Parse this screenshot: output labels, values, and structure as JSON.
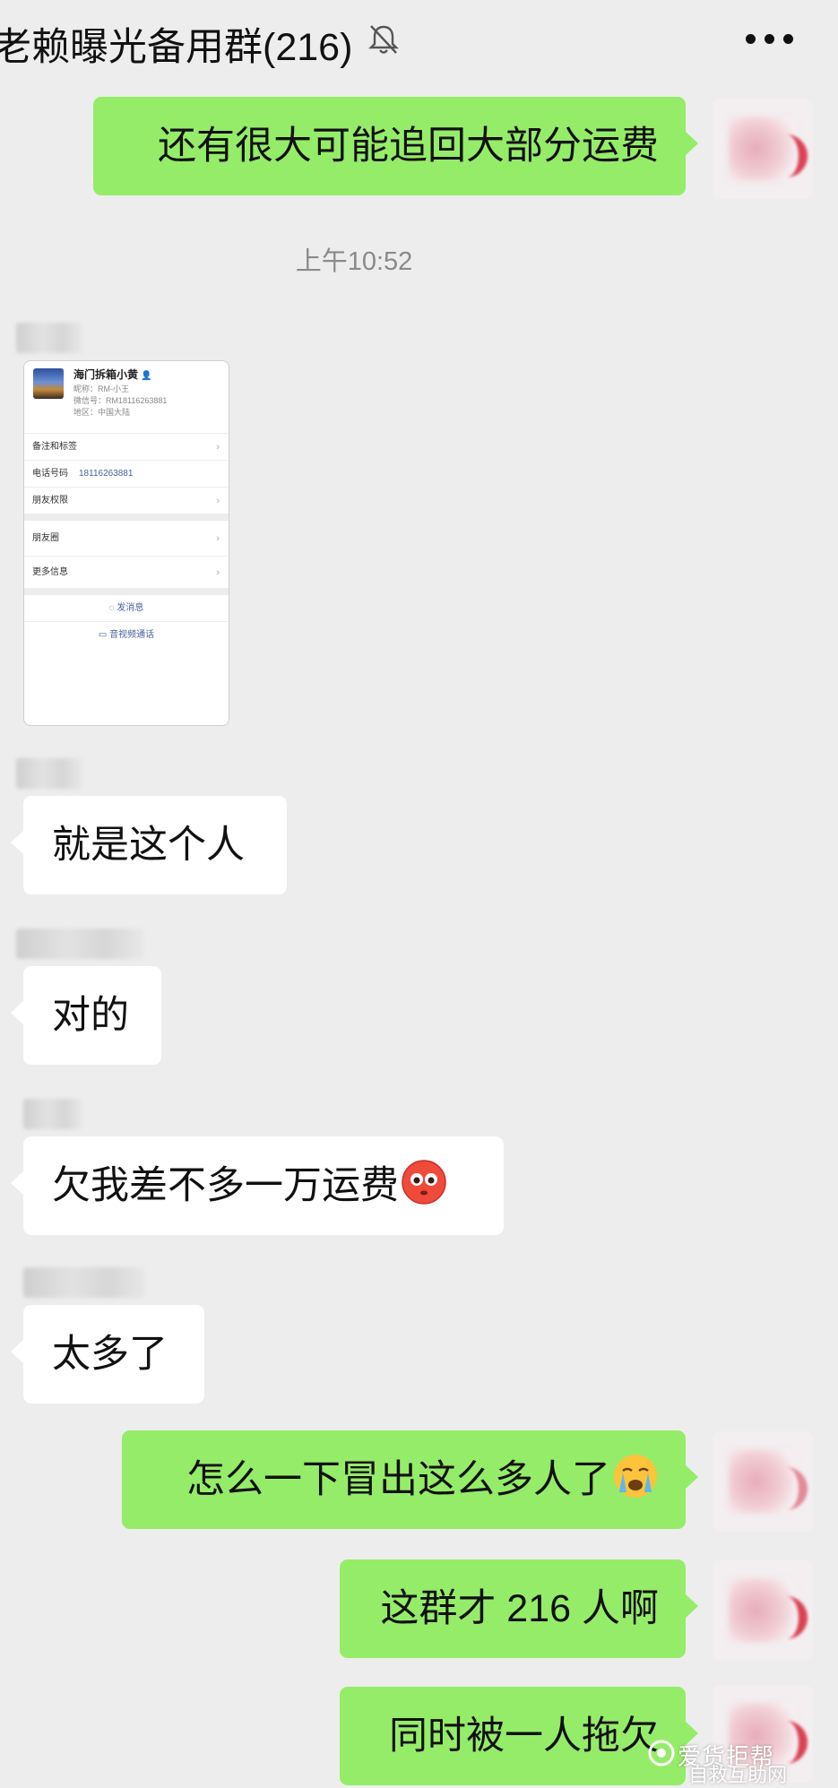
{
  "header": {
    "title": "老赖曝光备用群(216)",
    "mute_icon": "bell-off-icon",
    "more_icon": "more-dots-icon"
  },
  "timestamp": "上午10:52",
  "messages": {
    "m1": {
      "side": "right",
      "text": "还有很大可能追回大部分运费"
    },
    "m3": {
      "side": "left",
      "text": "就是这个人"
    },
    "m4": {
      "side": "left",
      "text": "对的"
    },
    "m5": {
      "side": "left",
      "text": "欠我差不多一万运费",
      "emoji": "flushed-face"
    },
    "m6": {
      "side": "left",
      "text": "太多了"
    },
    "m7": {
      "side": "right",
      "text": "怎么一下冒出这么多人了",
      "emoji": "loudly-crying-face"
    },
    "m8": {
      "side": "right",
      "text": "这群才 216 人啊"
    },
    "m9": {
      "side": "right",
      "text": "同时被一人拖欠"
    }
  },
  "profile_card": {
    "name": "海门拆箱小黄",
    "nickname": "昵称：RM-小王",
    "wechat_id": "微信号：RM18116263881",
    "region": "地区：中国大陆",
    "rows": {
      "remark": "备注和标签",
      "phone_label": "电话号码",
      "phone_value": "18116263881",
      "friend_permission": "朋友权限",
      "moments": "朋友圈",
      "more_info": "更多信息"
    },
    "actions": {
      "send_message": "发消息",
      "video_call": "音视频通话"
    }
  },
  "watermark": {
    "main": "爱货拒帮",
    "sub": "自救互助网"
  }
}
